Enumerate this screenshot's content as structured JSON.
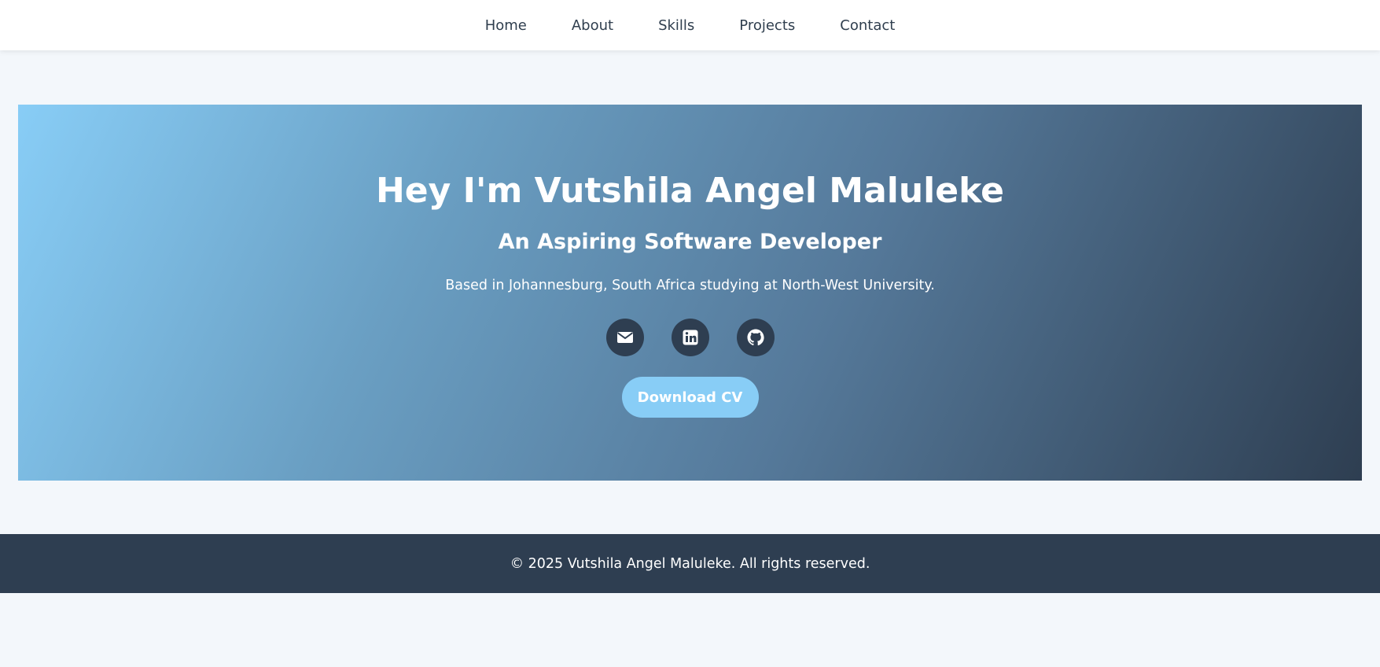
{
  "nav": {
    "items": [
      {
        "label": "Home"
      },
      {
        "label": "About"
      },
      {
        "label": "Skills"
      },
      {
        "label": "Projects"
      },
      {
        "label": "Contact"
      }
    ]
  },
  "hero": {
    "title": "Hey I'm Vutshila Angel Maluleke",
    "subtitle": "An Aspiring Software Developer",
    "location": "Based in Johannesburg, South Africa studying at North-West University.",
    "socials": [
      {
        "icon": "envelope-icon"
      },
      {
        "icon": "linkedin-icon"
      },
      {
        "icon": "github-icon"
      }
    ],
    "cv_button_label": "Download CV"
  },
  "footer": {
    "copyright": "© 2025 Vutshila Angel Maluleke. All rights reserved."
  },
  "colors": {
    "page_background": "#f3f7fb",
    "accent_light_blue": "#88cdf6",
    "dark_navy": "#2e3e51",
    "nav_text": "#2f3e4e"
  }
}
